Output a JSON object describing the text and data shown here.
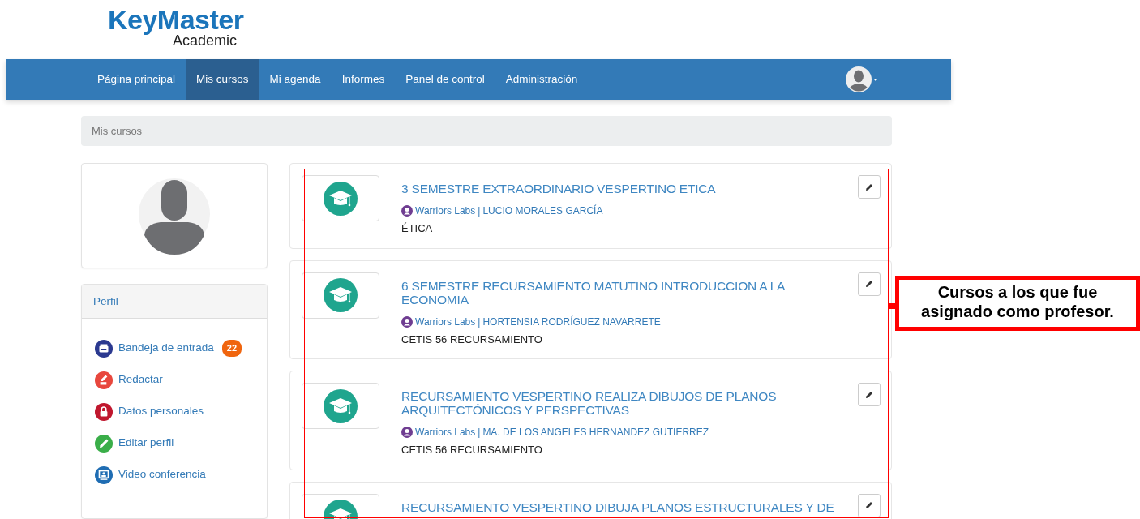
{
  "logo": {
    "brand": "KeyMaster",
    "subtitle": "Academic"
  },
  "nav": [
    {
      "label": "Página principal",
      "selected": false
    },
    {
      "label": "Mis cursos",
      "selected": true
    },
    {
      "label": "Mi agenda",
      "selected": false
    },
    {
      "label": "Informes",
      "selected": false
    },
    {
      "label": "Panel de control",
      "selected": false
    },
    {
      "label": "Administración",
      "selected": false
    }
  ],
  "breadcrumb": "Mis cursos",
  "profile_panel": {
    "title": "Perfil",
    "items": [
      {
        "label": "Bandeja de entrada",
        "badge": "22",
        "color": "#2b3990",
        "kind": "inbox"
      },
      {
        "label": "Redactar",
        "color": "#e8473d",
        "kind": "compose"
      },
      {
        "label": "Datos personales",
        "color": "#c0172e",
        "kind": "lock"
      },
      {
        "label": "Editar perfil",
        "color": "#3aae49",
        "kind": "pencil"
      },
      {
        "label": "Video conferencia",
        "color": "#1f6db3",
        "kind": "video"
      }
    ]
  },
  "courses": [
    {
      "title": "3 SEMESTRE EXTRAORDINARIO VESPERTINO ETICA",
      "organization": "Warriors Labs",
      "separator": "|",
      "teacher": "LUCIO MORALES GARCÍA",
      "category": "ÉTICA"
    },
    {
      "title": "6 SEMESTRE RECURSAMIENTO MATUTINO INTRODUCCION A LA ECONOMIA",
      "organization": "Warriors Labs",
      "separator": "|",
      "teacher": "HORTENSIA RODRÍGUEZ NAVARRETE",
      "category": "CETIS 56 RECURSAMIENTO"
    },
    {
      "title": "RECURSAMIENTO VESPERTINO REALIZA DIBUJOS DE PLANOS ARQUITECTÓNICOS Y PERSPECTIVAS",
      "organization": "Warriors Labs",
      "separator": "|",
      "teacher": "MA. DE LOS ANGELES HERNANDEZ GUTIERREZ",
      "category": "CETIS 56 RECURSAMIENTO"
    },
    {
      "title": "RECURSAMIENTO VESPERTINO DIBUJA PLANOS ESTRUCTURALES Y DE"
    }
  ],
  "annotation": {
    "text": "Cursos a los que fue asignado como profesor."
  }
}
